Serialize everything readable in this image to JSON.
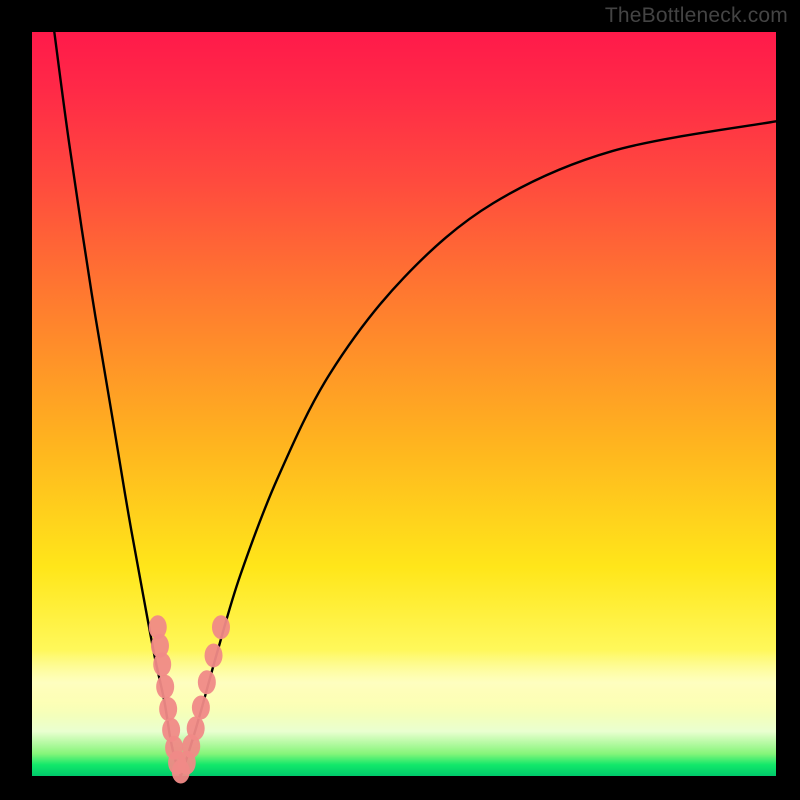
{
  "watermark": "TheBottleneck.com",
  "colors": {
    "curve": "#000000",
    "marker_fill": "#f08a87",
    "marker_stroke": "#c05a55",
    "background_black": "#000000"
  },
  "chart_data": {
    "type": "line",
    "title": "",
    "xlabel": "",
    "ylabel": "",
    "xlim": [
      0,
      100
    ],
    "ylim": [
      0,
      100
    ],
    "note": "Axes are unlabeled in the source image. x and y are normalized 0–100 estimated from pixel positions. Two curves descend into a narrow V near x≈20 and y≈0.",
    "series": [
      {
        "name": "left-curve",
        "x": [
          3,
          5,
          8,
          11,
          13,
          15,
          16.5,
          17.8,
          18.6,
          19.3,
          20
        ],
        "y": [
          100,
          85,
          65,
          47,
          35,
          24,
          16,
          10,
          5,
          2,
          0
        ]
      },
      {
        "name": "right-curve",
        "x": [
          20,
          21,
          22.5,
          25,
          28,
          33,
          40,
          50,
          62,
          78,
          100
        ],
        "y": [
          0,
          3,
          8,
          17,
          27,
          40,
          54,
          67,
          77,
          84,
          88
        ]
      }
    ],
    "markers_left": [
      {
        "x": 16.9,
        "y": 20.0
      },
      {
        "x": 17.2,
        "y": 17.5
      },
      {
        "x": 17.5,
        "y": 15.0
      },
      {
        "x": 17.9,
        "y": 12.0
      },
      {
        "x": 18.3,
        "y": 9.0
      },
      {
        "x": 18.7,
        "y": 6.2
      },
      {
        "x": 19.1,
        "y": 3.8
      },
      {
        "x": 19.5,
        "y": 1.8
      },
      {
        "x": 20.0,
        "y": 0.6
      }
    ],
    "markers_right": [
      {
        "x": 20.8,
        "y": 1.8
      },
      {
        "x": 21.4,
        "y": 4.0
      },
      {
        "x": 22.0,
        "y": 6.4
      },
      {
        "x": 22.7,
        "y": 9.2
      },
      {
        "x": 23.5,
        "y": 12.6
      },
      {
        "x": 24.4,
        "y": 16.2
      },
      {
        "x": 25.4,
        "y": 20.0
      }
    ]
  }
}
